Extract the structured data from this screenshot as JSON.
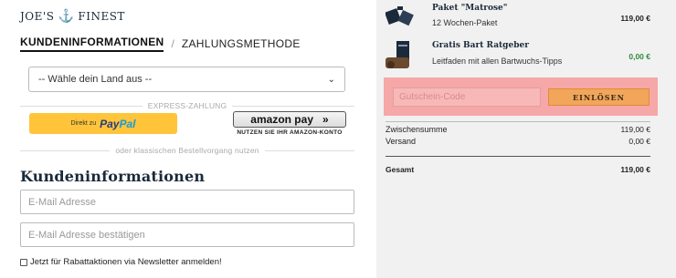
{
  "logo": {
    "left": "JOE'S",
    "anchor": "⚓",
    "right": "FINEST"
  },
  "steps": {
    "active": "KUNDENINFORMATIONEN",
    "separator": "/",
    "inactive": "ZAHLUNGSMETHODE"
  },
  "country_select": {
    "value": "-- Wähle dein Land aus --"
  },
  "express_label": "EXPRESS-ZAHLUNG",
  "paypal": {
    "prefix": "Direkt zu",
    "brand_a": "Pay",
    "brand_b": "Pal"
  },
  "amazon": {
    "brand": "amazon pay",
    "arrow": "»",
    "subtitle": "NUTZEN SIE IHR AMAZON-KONTO"
  },
  "classic_label": "oder klassischen Bestellvorgang nutzen",
  "customer_section": {
    "title": "Kundeninformationen",
    "email_placeholder": "E-Mail Adresse",
    "email_confirm_placeholder": "E-Mail Adresse bestätigen",
    "newsletter_label": "Jetzt für Rabattaktionen via Newsletter anmelden!"
  },
  "cart": {
    "items": [
      {
        "name": "Paket \"Matrose\"",
        "desc": "12 Wochen-Paket",
        "price": "119,00 €"
      },
      {
        "name": "Gratis Bart Ratgeber",
        "desc": "Leitfaden mit allen Bartwuchs-Tipps",
        "price": "0,00 €"
      }
    ],
    "coupon_placeholder": "Gutschein-Code",
    "coupon_button": "EINLÖSEN",
    "subtotal_label": "Zwischensumme",
    "subtotal_value": "119,00 €",
    "shipping_label": "Versand",
    "shipping_value": "0,00 €",
    "total_label": "Gesamt",
    "total_value": "119,00 €"
  },
  "colors": {
    "brand_navy": "#1b2a3a",
    "paypal_yellow": "#ffc439",
    "coupon_highlight": "#f6a7a7",
    "coupon_button": "#f2a65a",
    "free_green": "#2e8b3a",
    "sidebar_bg": "#f1f1f1"
  }
}
